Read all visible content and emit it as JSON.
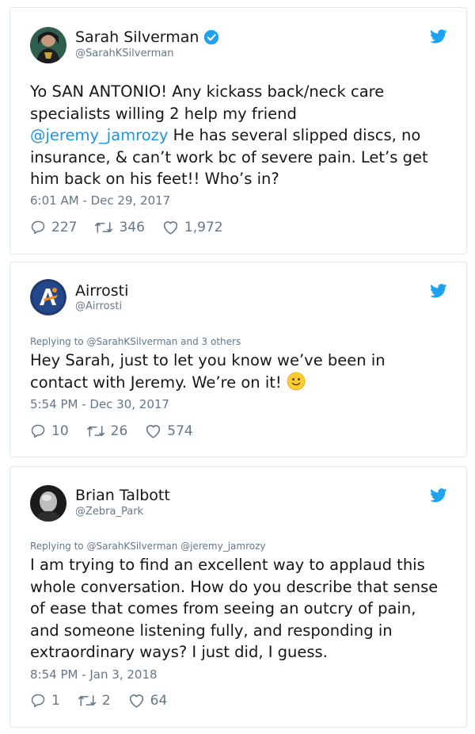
{
  "tweets": [
    {
      "name": "Sarah Silverman",
      "handle": "@SarahKSilverman",
      "verified": true,
      "reply_to": "",
      "text_before": "Yo SAN ANTONIO! Any kickass back/neck care\nspecialists willing 2 help my friend\n",
      "mention": "@jeremy_jamrozy",
      "text_after": " He has several slipped discs, no\ninsurance, & can’t work bc of severe pain. Let’s get\nhim back on his feet!! Who’s in?",
      "timestamp": "6:01 AM - Dec 29, 2017",
      "replies": "227",
      "retweets": "346",
      "likes": "1,972"
    },
    {
      "name": "Airrosti",
      "handle": "@Airrosti",
      "verified": false,
      "reply_to": "Replying to @SarahKSilverman and 3 others",
      "text": "Hey Sarah, just to let you know we’ve been in\ncontact with Jeremy. We’re on it!",
      "emoji_icon": "slightly-smiling-face-icon",
      "timestamp": "5:54 PM - Dec 30, 2017",
      "replies": "10",
      "retweets": "26",
      "likes": "574"
    },
    {
      "name": "Brian Talbott",
      "handle": "@Zebra_Park",
      "verified": false,
      "reply_to": "Replying to @SarahKSilverman @jeremy_jamrozy",
      "text": "I am trying to find an excellent way to applaud this\nwhole conversation. How do you describe that sense\nof ease that comes from seeing an outcry of pain,\nand someone listening fully, and responding in\nextraordinary ways? I just did, I guess.",
      "timestamp": "8:54 PM - Jan 3, 2018",
      "replies": "1",
      "retweets": "2",
      "likes": "64"
    }
  ],
  "colors": {
    "twitter_blue": "#1da1f2",
    "link": "#1b95e0",
    "secondary_text": "#657786",
    "border": "#e1e8ed"
  }
}
